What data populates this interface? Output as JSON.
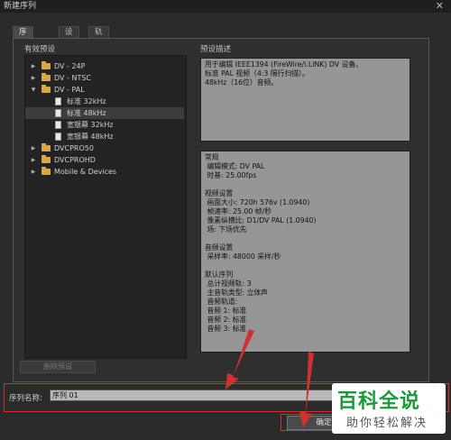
{
  "window": {
    "title": "新建序列",
    "close_glyph": "✕"
  },
  "tabs": [
    {
      "label": "序列预设",
      "active": true
    },
    {
      "label": "设置",
      "active": false
    },
    {
      "label": "轨道",
      "active": false
    }
  ],
  "presets_label": "有效预设",
  "desc_label": "预设描述",
  "tree": [
    {
      "label": "DV - 24P",
      "type": "folder",
      "expanded": false
    },
    {
      "label": "DV - NTSC",
      "type": "folder",
      "expanded": false
    },
    {
      "label": "DV - PAL",
      "type": "folder",
      "expanded": true
    },
    {
      "label": "标准 32kHz",
      "type": "file",
      "selected": false
    },
    {
      "label": "标准 48kHz",
      "type": "file",
      "selected": true
    },
    {
      "label": "宽银幕 32kHz",
      "type": "file",
      "selected": false
    },
    {
      "label": "宽银幕 48kHz",
      "type": "file",
      "selected": false
    },
    {
      "label": "DVCPRO50",
      "type": "folder",
      "expanded": false
    },
    {
      "label": "DVCPROHD",
      "type": "folder",
      "expanded": false
    },
    {
      "label": "Mobile & Devices",
      "type": "folder",
      "expanded": false
    }
  ],
  "description": "用于编辑 IEEE1394 (FireWire/i.LINK) DV 设备。\n标准 PAL 视频（4:3 隔行扫描）。\n48kHz（16位）音频。",
  "details": "常规\n 编辑模式: DV PAL\n 时基: 25.00fps\n\n视频设置\n 画面大小: 720h 576v (1.0940)\n 帧速率: 25.00 帧/秒\n 像素纵横比: D1/DV PAL (1.0940)\n 场: 下场优先\n\n音频设置\n 采样率: 48000 采样/秒\n\n默认序列\n 总计视频轨: 3\n 主音轨类型: 立体声\n 音频轨道:\n 音频 1: 标准\n 音频 2: 标准\n 音频 3: 标准",
  "delete_button": "删除预设",
  "sequence_name": {
    "label": "序列名称:",
    "value": "序列 01"
  },
  "ok_button": "确定",
  "watermark": {
    "big": "百科全说",
    "small": "助你轻松解决"
  },
  "colors": {
    "annotation_red": "#d03030",
    "watermark_green": "#1a9a3a"
  }
}
